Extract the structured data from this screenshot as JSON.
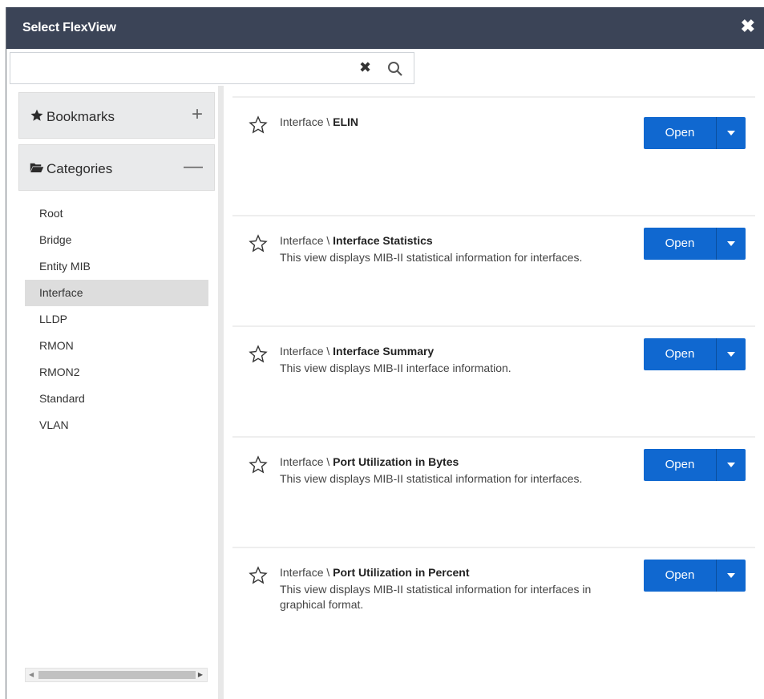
{
  "dialog": {
    "title": "Select FlexView"
  },
  "search": {
    "value": "",
    "placeholder": ""
  },
  "sidebar": {
    "bookmarks_label": "Bookmarks",
    "categories_label": "Categories",
    "categories": [
      {
        "label": "Root",
        "selected": false
      },
      {
        "label": "Bridge",
        "selected": false
      },
      {
        "label": "Entity MIB",
        "selected": false
      },
      {
        "label": "Interface",
        "selected": true
      },
      {
        "label": "LLDP",
        "selected": false
      },
      {
        "label": "RMON",
        "selected": false
      },
      {
        "label": "RMON2",
        "selected": false
      },
      {
        "label": "Standard",
        "selected": false
      },
      {
        "label": "VLAN",
        "selected": false
      }
    ]
  },
  "views": [
    {
      "category": "Interface \\ ",
      "name": "ELIN",
      "description": "",
      "open_label": "Open"
    },
    {
      "category": "Interface \\ ",
      "name": "Interface Statistics",
      "description": "This view displays MIB-II statistical information for interfaces.",
      "open_label": "Open"
    },
    {
      "category": "Interface \\ ",
      "name": "Interface Summary",
      "description": "This view displays MIB-II interface information.",
      "open_label": "Open"
    },
    {
      "category": "Interface \\ ",
      "name": "Port Utilization in Bytes",
      "description": "This view displays MIB-II statistical information for interfaces.",
      "open_label": "Open"
    },
    {
      "category": "Interface \\ ",
      "name": "Port Utilization in Percent",
      "description": "This view displays MIB-II statistical information for interfaces in graphical format.",
      "open_label": "Open"
    }
  ],
  "colors": {
    "titlebar": "#3b4457",
    "accent": "#1068d0",
    "selected": "#dddddd"
  },
  "icons": {
    "close": "close-icon",
    "clear": "clear-search-icon",
    "search": "search-icon",
    "bookmarks": "star-icon",
    "categories": "folder-open-icon",
    "favorite": "star-outline-icon"
  }
}
